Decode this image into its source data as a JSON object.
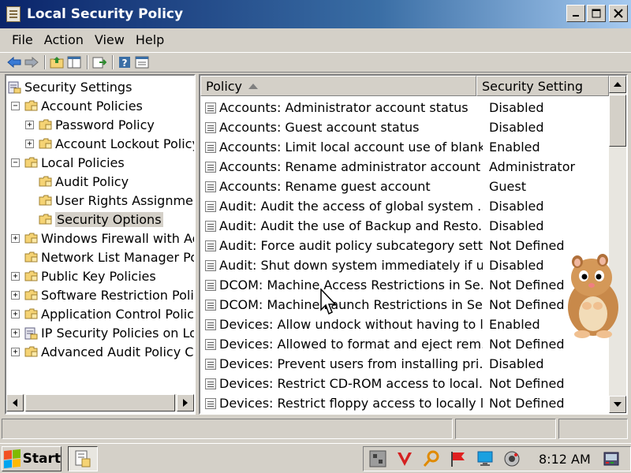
{
  "window": {
    "title": "Local Security Policy"
  },
  "menu": [
    "File",
    "Action",
    "View",
    "Help"
  ],
  "tree": [
    {
      "label": "Security Settings",
      "level": 0,
      "expander": "",
      "icon": "shield"
    },
    {
      "label": "Account Policies",
      "level": 1,
      "expander": "−",
      "icon": "folder"
    },
    {
      "label": "Password Policy",
      "level": 2,
      "expander": "+",
      "icon": "folder"
    },
    {
      "label": "Account Lockout Policy",
      "level": 2,
      "expander": "+",
      "icon": "folder"
    },
    {
      "label": "Local Policies",
      "level": 1,
      "expander": "−",
      "icon": "folder"
    },
    {
      "label": "Audit Policy",
      "level": 2,
      "expander": "",
      "icon": "folder"
    },
    {
      "label": "User Rights Assignment",
      "level": 2,
      "expander": "",
      "icon": "folder"
    },
    {
      "label": "Security Options",
      "level": 2,
      "expander": "",
      "icon": "folder",
      "selected": true
    },
    {
      "label": "Windows Firewall with Adv",
      "level": 1,
      "expander": "+",
      "icon": "folder"
    },
    {
      "label": "Network List Manager Polic",
      "level": 1,
      "expander": "",
      "icon": "folder"
    },
    {
      "label": "Public Key Policies",
      "level": 1,
      "expander": "+",
      "icon": "folder"
    },
    {
      "label": "Software Restriction Policie",
      "level": 1,
      "expander": "+",
      "icon": "folder"
    },
    {
      "label": "Application Control Policies",
      "level": 1,
      "expander": "+",
      "icon": "folder"
    },
    {
      "label": "IP Security Policies on Loca",
      "level": 1,
      "expander": "+",
      "icon": "shield"
    },
    {
      "label": "Advanced Audit Policy Conf",
      "level": 1,
      "expander": "+",
      "icon": "folder"
    }
  ],
  "list": {
    "columns": {
      "policy": "Policy",
      "setting": "Security Setting"
    },
    "rows": [
      {
        "policy": "Accounts: Administrator account status",
        "setting": "Disabled"
      },
      {
        "policy": "Accounts: Guest account status",
        "setting": "Disabled"
      },
      {
        "policy": "Accounts: Limit local account use of blank...",
        "setting": "Enabled"
      },
      {
        "policy": "Accounts: Rename administrator account",
        "setting": "Administrator"
      },
      {
        "policy": "Accounts: Rename guest account",
        "setting": "Guest"
      },
      {
        "policy": "Audit: Audit the access of global system ...",
        "setting": "Disabled"
      },
      {
        "policy": "Audit: Audit the use of Backup and Resto...",
        "setting": "Disabled"
      },
      {
        "policy": "Audit: Force audit policy subcategory sett...",
        "setting": "Not Defined"
      },
      {
        "policy": "Audit: Shut down system immediately if u...",
        "setting": "Disabled"
      },
      {
        "policy": "DCOM: Machine Access Restrictions in Se...",
        "setting": "Not Defined"
      },
      {
        "policy": "DCOM: Machine Launch Restrictions in Se...",
        "setting": "Not Defined"
      },
      {
        "policy": "Devices: Allow undock without having to l...",
        "setting": "Enabled"
      },
      {
        "policy": "Devices: Allowed to format and eject rem...",
        "setting": "Not Defined"
      },
      {
        "policy": "Devices: Prevent users from installing pri...",
        "setting": "Disabled"
      },
      {
        "policy": "Devices: Restrict CD-ROM access to local...",
        "setting": "Not Defined"
      },
      {
        "policy": "Devices: Restrict floppy access to locally l...",
        "setting": "Not Defined"
      }
    ]
  },
  "taskbar": {
    "start_label": "Start",
    "clock": "8:12 AM",
    "tray_icons": [
      "network-icon",
      "antivirus-icon",
      "search-icon",
      "flag-icon",
      "monitor-icon",
      "speaker-icon"
    ]
  },
  "colors": {
    "title_bar": "#0a246a",
    "folder": "#f5d374"
  }
}
